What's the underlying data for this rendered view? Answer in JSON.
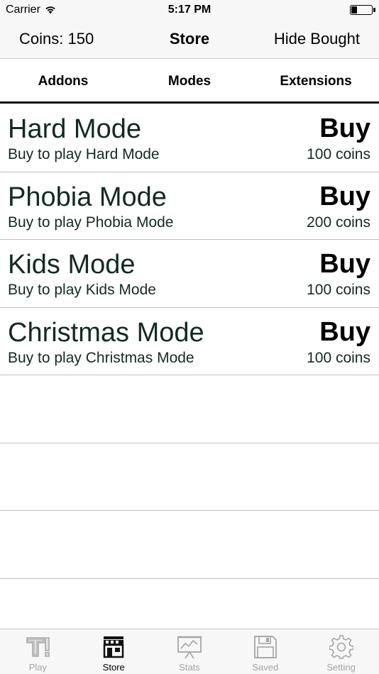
{
  "status_bar": {
    "carrier": "Carrier",
    "time": "5:17 PM",
    "battery_level": 0.25
  },
  "nav": {
    "coins": "Coins: 150",
    "title": "Store",
    "right_button": "Hide Bought"
  },
  "segments": [
    {
      "label": "Addons"
    },
    {
      "label": "Modes"
    },
    {
      "label": "Extensions"
    }
  ],
  "items": [
    {
      "title": "Hard Mode",
      "subtitle": "Buy to play Hard Mode",
      "action": "Buy",
      "price": "100 coins"
    },
    {
      "title": "Phobia Mode",
      "subtitle": "Buy to play Phobia Mode",
      "action": "Buy",
      "price": "200 coins"
    },
    {
      "title": "Kids Mode",
      "subtitle": "Buy to play Kids Mode",
      "action": "Buy",
      "price": "100 coins"
    },
    {
      "title": "Christmas Mode",
      "subtitle": "Buy to play Christmas Mode",
      "action": "Buy",
      "price": "100 coins"
    }
  ],
  "tabs": [
    {
      "label": "Play",
      "icon": "play-t-icon",
      "active": false
    },
    {
      "label": "Store",
      "icon": "store-icon",
      "active": true
    },
    {
      "label": "Stats",
      "icon": "stats-chart-icon",
      "active": false
    },
    {
      "label": "Saved",
      "icon": "floppy-disk-icon",
      "active": false
    },
    {
      "label": "Setting",
      "icon": "gear-icon",
      "active": false
    }
  ],
  "colors": {
    "text_dark_green": "#142a20",
    "tab_inactive": "#a5a5a5",
    "bar_bg": "#f7f7f7"
  }
}
